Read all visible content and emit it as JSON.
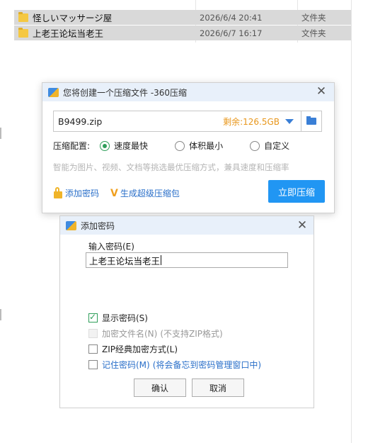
{
  "explorer": {
    "files": [
      {
        "name": "怪しいマッサージ屋",
        "date": "2026/6/4 20:41",
        "type": "文件夹"
      },
      {
        "name": "上老王论坛当老王",
        "date": "2026/6/7 16:17",
        "type": "文件夹"
      }
    ]
  },
  "compress_dialog": {
    "title": "您将创建一个压缩文件 -360压缩",
    "filename": "B9499.zip",
    "free_space": "剩余:126.5GB",
    "config_label": "压缩配置:",
    "options": [
      "速度最快",
      "体积最小",
      "自定义"
    ],
    "selected_option": "速度最快",
    "hint": "智能为图片、视频、文档等挑选最优压缩方式，兼具速度和压缩率",
    "add_password": "添加密码",
    "super_package": "生成超级压缩包",
    "compress_now": "立即压缩"
  },
  "password_dialog": {
    "title": "添加密码",
    "input_label": "输入密码(E)",
    "password_value": "上老王论坛当老王",
    "show_password": {
      "label": "显示密码(S)",
      "checked": true
    },
    "encrypt_names": {
      "label": "加密文件名(N)",
      "note": "(不支持ZIP格式)",
      "checked": false,
      "disabled": true
    },
    "zip_classic": {
      "label": "ZIP经典加密方式(L)",
      "checked": false
    },
    "remember_password": {
      "label": "记住密码(M)",
      "note": "(将会备忘到密码管理窗口中)",
      "checked": false
    },
    "ok_label": "确认",
    "cancel_label": "取消"
  },
  "colors": {
    "primary": "#2196f3",
    "accent_orange": "#e8961a",
    "link_blue": "#2a6fc9",
    "check_green": "#2f9e5a"
  }
}
